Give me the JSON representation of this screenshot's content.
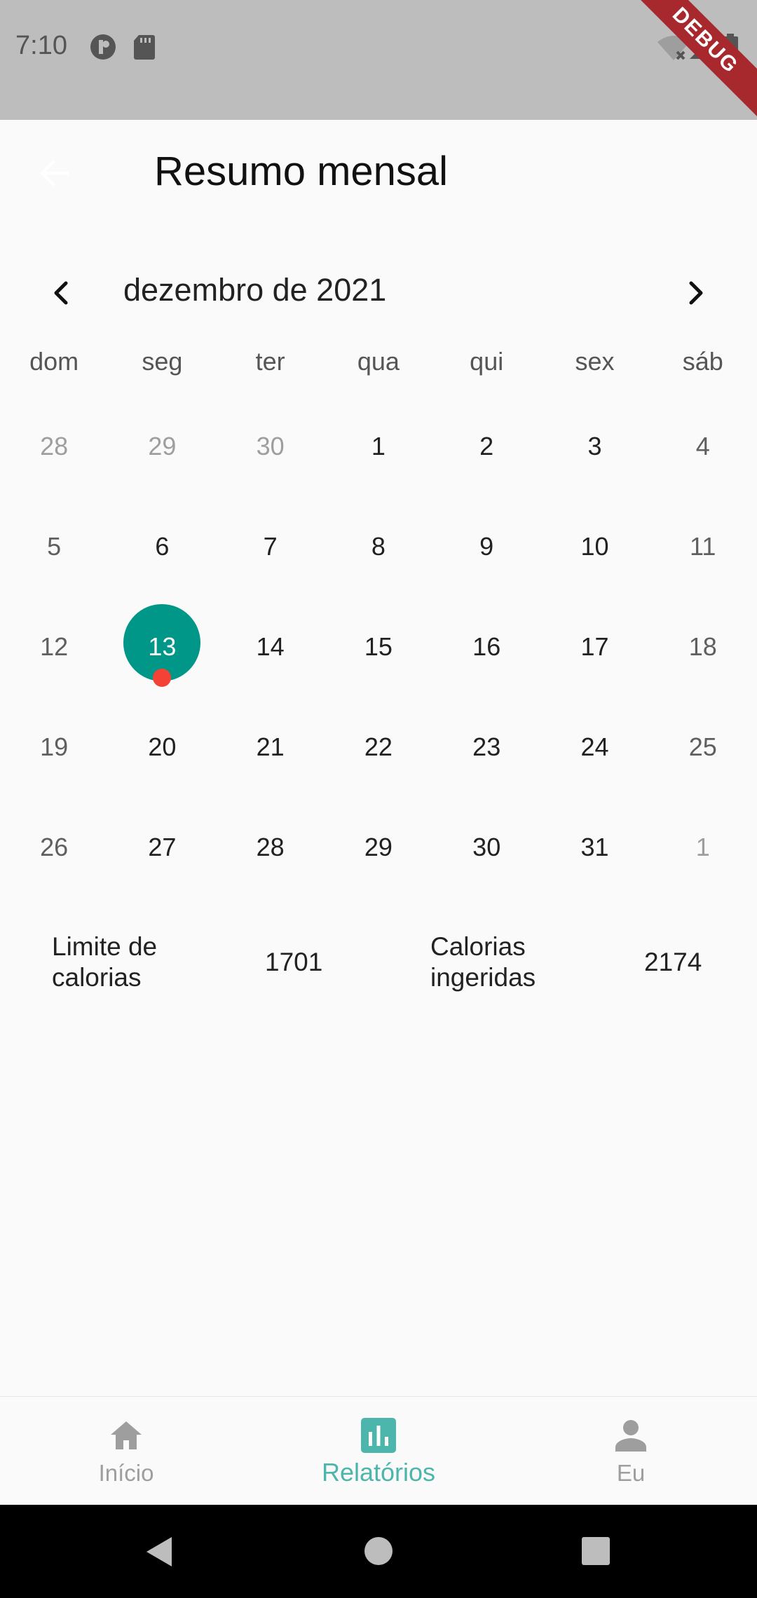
{
  "status_bar": {
    "time": "7:10",
    "debug_label": "DEBUG"
  },
  "app_bar": {
    "title": "Resumo mensal"
  },
  "calendar": {
    "month_label": "dezembro de 2021",
    "weekdays": [
      "dom",
      "seg",
      "ter",
      "qua",
      "qui",
      "sex",
      "sáb"
    ],
    "weeks": [
      [
        "28",
        "29",
        "30",
        "1",
        "2",
        "3",
        "4"
      ],
      [
        "5",
        "6",
        "7",
        "8",
        "9",
        "10",
        "11"
      ],
      [
        "12",
        "13",
        "14",
        "15",
        "16",
        "17",
        "18"
      ],
      [
        "19",
        "20",
        "21",
        "22",
        "23",
        "24",
        "25"
      ],
      [
        "26",
        "27",
        "28",
        "29",
        "30",
        "31",
        "1"
      ]
    ],
    "selected_day": "13",
    "selected_color": "#009688",
    "event_marker_color": "#f44336"
  },
  "summary": {
    "limit_label": "Limite de calorias",
    "limit_value": "1701",
    "ingested_label": "Calorias ingeridas",
    "ingested_value": "2174"
  },
  "bottom_nav": {
    "items": [
      {
        "label": "Início",
        "icon": "home-icon"
      },
      {
        "label": "Relatórios",
        "icon": "bar-chart-icon",
        "active": true
      },
      {
        "label": "Eu",
        "icon": "person-icon"
      }
    ],
    "active_color": "#4db6ac"
  }
}
